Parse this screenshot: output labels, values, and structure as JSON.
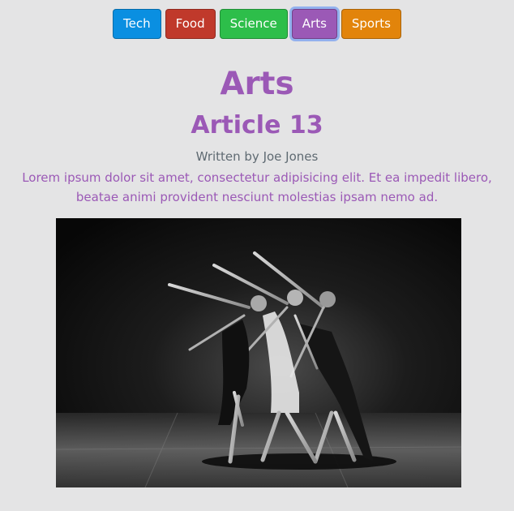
{
  "nav": {
    "items": [
      {
        "label": "Tech",
        "color": "#0a8fe1"
      },
      {
        "label": "Food",
        "color": "#c0392b"
      },
      {
        "label": "Science",
        "color": "#2dbe4a"
      },
      {
        "label": "Arts",
        "color": "#9b59b6"
      },
      {
        "label": "Sports",
        "color": "#e2840b"
      }
    ],
    "active": "Arts"
  },
  "section": {
    "title": "Arts",
    "color": "#9b59b6"
  },
  "article": {
    "title": "Article 13",
    "byline": "Written by Joe Jones",
    "summary": "Lorem ipsum dolor sit amet, consectetur adipisicing elit. Et ea impedit libero, beatae animi provident nesciunt molestias ipsam nemo ad.",
    "image_alt": "dance-photo"
  }
}
